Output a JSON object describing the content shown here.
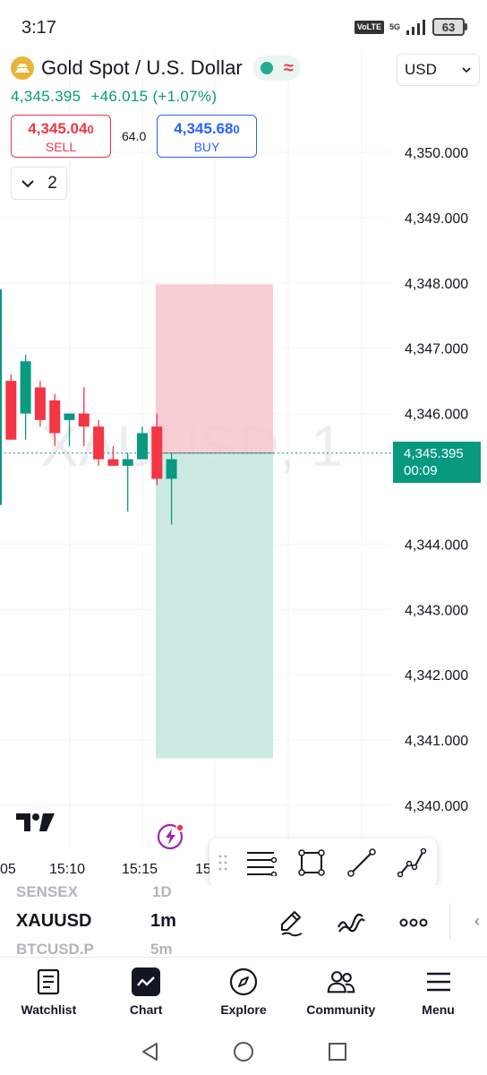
{
  "status_bar": {
    "time": "3:17",
    "volte": "VoLTE",
    "network": "5G",
    "battery": "63"
  },
  "header": {
    "symbol_name": "Gold Spot / U.S. Dollar",
    "currency": "USD",
    "last_price": "4,345.395",
    "change": "+46.015",
    "change_pct": "(+1.07%)"
  },
  "order_panel": {
    "sell_price_main": "4,345.04",
    "sell_price_sup": "0",
    "sell_label": "SELL",
    "buy_price_main": "4,345.68",
    "buy_price_sup": "0",
    "buy_label": "BUY",
    "spread": "64.0"
  },
  "indicator_toggle": {
    "count": "2"
  },
  "chart": {
    "watermark": "XAUUSD, 1",
    "current_price_label": "4,345.395",
    "countdown": "00:09",
    "y_ticks": [
      "4,350.000",
      "4,349.000",
      "4,348.000",
      "4,347.000",
      "4,346.000",
      "4,344.000",
      "4,343.000",
      "4,342.000",
      "4,341.000",
      "4,340.000"
    ],
    "x_ticks": [
      "05",
      "15:10",
      "15:15",
      "15:"
    ],
    "colors": {
      "up": "#089981",
      "down": "#f23645",
      "stop_zone": "#f7c6cc",
      "target_zone": "#c7e8df"
    }
  },
  "chart_data": {
    "type": "candlestick",
    "title": "XAUUSD, 1",
    "ylim": [
      4339.8,
      4350.6
    ],
    "y_ticks": [
      4350,
      4349,
      4348,
      4347,
      4346,
      4344,
      4343,
      4342,
      4341,
      4340
    ],
    "x_labels": [
      "05",
      "15:10",
      "15:15",
      "15:"
    ],
    "candles": [
      {
        "o": 4344.6,
        "h": 4348.1,
        "l": 4344.6,
        "c": 4347.9
      },
      {
        "o": 4346.5,
        "h": 4346.6,
        "l": 4345.6,
        "c": 4345.6
      },
      {
        "o": 4346.0,
        "h": 4346.9,
        "l": 4345.6,
        "c": 4346.8
      },
      {
        "o": 4346.4,
        "h": 4346.5,
        "l": 4345.8,
        "c": 4345.9
      },
      {
        "o": 4346.2,
        "h": 4346.3,
        "l": 4345.5,
        "c": 4345.7
      },
      {
        "o": 4345.9,
        "h": 4346.0,
        "l": 4345.5,
        "c": 4346.0
      },
      {
        "o": 4346.0,
        "h": 4346.4,
        "l": 4345.5,
        "c": 4345.8
      },
      {
        "o": 4345.8,
        "h": 4345.9,
        "l": 4345.2,
        "c": 4345.3
      },
      {
        "o": 4345.3,
        "h": 4345.5,
        "l": 4345.2,
        "c": 4345.2
      },
      {
        "o": 4345.2,
        "h": 4345.4,
        "l": 4344.5,
        "c": 4345.3
      },
      {
        "o": 4345.3,
        "h": 4345.8,
        "l": 4345.3,
        "c": 4345.7
      },
      {
        "o": 4345.8,
        "h": 4346.0,
        "l": 4344.9,
        "c": 4345.0
      },
      {
        "o": 4345.0,
        "h": 4345.4,
        "l": 4344.3,
        "c": 4345.3
      }
    ],
    "current_price": 4345.395,
    "position": {
      "entry": 4345.395,
      "stop": 4347.98,
      "target": 4340.72
    }
  },
  "watchlist_strip": {
    "prev_symbol": "SENSEX",
    "prev_interval": "1D",
    "symbol": "XAUUSD",
    "interval": "1m",
    "next_symbol": "BTCUSD.P",
    "next_interval": "5m"
  },
  "bottom_nav": {
    "items": [
      {
        "label": "Watchlist"
      },
      {
        "label": "Chart"
      },
      {
        "label": "Explore"
      },
      {
        "label": "Community"
      },
      {
        "label": "Menu"
      }
    ]
  }
}
